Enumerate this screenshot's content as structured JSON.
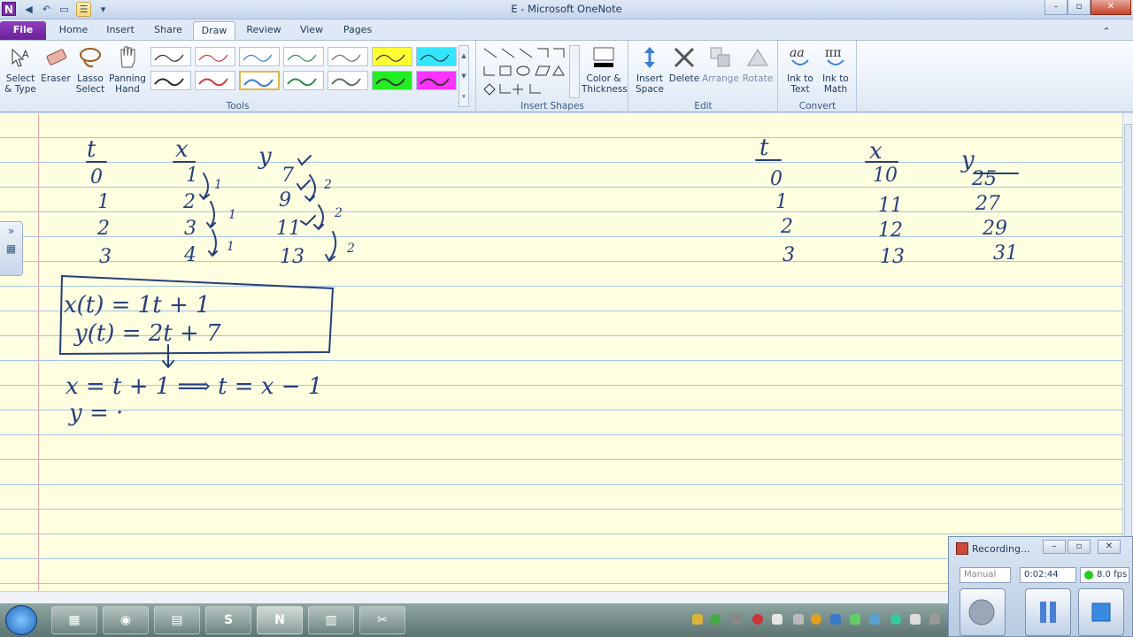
{
  "window": {
    "title": "E - Microsoft OneNote",
    "app_icon": "N",
    "controls": [
      "–",
      "▫",
      "✕"
    ]
  },
  "tabs": [
    "File",
    "Home",
    "Insert",
    "Share",
    "Draw",
    "Review",
    "View",
    "Pages"
  ],
  "active_tab": "Draw",
  "ribbon": {
    "tools": {
      "label": "Tools",
      "select": "Select & Type",
      "eraser": "Eraser",
      "lasso": "Lasso Select",
      "panning": "Panning Hand"
    },
    "insert_shapes": {
      "label": "Insert Shapes",
      "color_thickness": "Color & Thickness"
    },
    "edit": {
      "label": "Edit",
      "insert_space": "Insert Space",
      "delete": "Delete",
      "arrange": "Arrange",
      "rotate": "Rotate"
    },
    "convert": {
      "label": "Convert",
      "ink_to_text": "Ink to Text",
      "ink_to_math": "Ink to Math"
    },
    "pen_colors": [
      "#2b2b2b",
      "#d23b3b",
      "#3a7ad6",
      "#2f8a4a",
      "#5f6f6f",
      "#ffff33",
      "#33e6ff",
      "#2b2b2b",
      "#d23b3b",
      "#3a7ad6",
      "#2f8a4a",
      "#5f6f6f",
      "#22ee22",
      "#ff33ff"
    ]
  },
  "notes": {
    "left_headers": {
      "t": "t",
      "x": "x",
      "y": "y"
    },
    "left_rows": [
      {
        "t": "0",
        "x": "1",
        "y": "7"
      },
      {
        "t": "1",
        "x": "2",
        "y": "9"
      },
      {
        "t": "2",
        "x": "3",
        "y": "11"
      },
      {
        "t": "3",
        "x": "4",
        "y": "13"
      }
    ],
    "x_diffs": [
      "1",
      "1",
      "1"
    ],
    "y_diffs": [
      "2",
      "2",
      "2"
    ],
    "equations_box": {
      "line1": "x(t) = 1t + 1",
      "line2": "y(t) = 2t + 7"
    },
    "derivation_line1": "x = t + 1  ⟹  t = x − 1",
    "derivation_line2": "y = ·",
    "right_headers": {
      "t": "t",
      "x": "x",
      "y": "y"
    },
    "right_rows": [
      {
        "t": "0",
        "x": "10",
        "y": "25"
      },
      {
        "t": "1",
        "x": "11",
        "y": "27"
      },
      {
        "t": "2",
        "x": "12",
        "y": "29"
      },
      {
        "t": "3",
        "x": "13",
        "y": "31"
      }
    ]
  },
  "recorder": {
    "title": "Recording...",
    "mode": "Manual",
    "elapsed": "0:02:44",
    "fps": "8.0 fps",
    "status_color": "#22cc22"
  },
  "taskbar": {
    "pinned": [
      "start",
      "calculator-app",
      "chrome",
      "notepad-app",
      "skype",
      "onenote",
      "calculator",
      "snipping-tool"
    ]
  }
}
